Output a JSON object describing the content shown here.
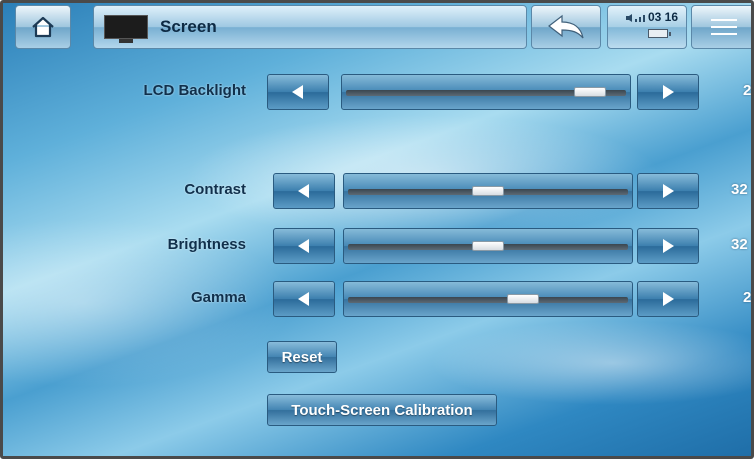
{
  "header": {
    "title": "Screen",
    "clock": "03 16"
  },
  "icons": {
    "home": "home-icon",
    "screen": "screen-icon",
    "back": "back-arrow-icon",
    "volume": "volume-icon",
    "battery": "battery-icon",
    "menu": "menu-icon",
    "decrease": "left-arrow-icon",
    "increase": "right-arrow-icon"
  },
  "settings": [
    {
      "label": "LCD Backlight",
      "value": "2",
      "level": 0.92
    },
    {
      "label": "Contrast",
      "value": "32",
      "level": 0.5
    },
    {
      "label": "Brightness",
      "value": "32",
      "level": 0.5
    },
    {
      "label": "Gamma",
      "value": "2",
      "level": 0.64
    }
  ],
  "buttons": {
    "reset": "Reset",
    "calibration": "Touch-Screen Calibration"
  }
}
